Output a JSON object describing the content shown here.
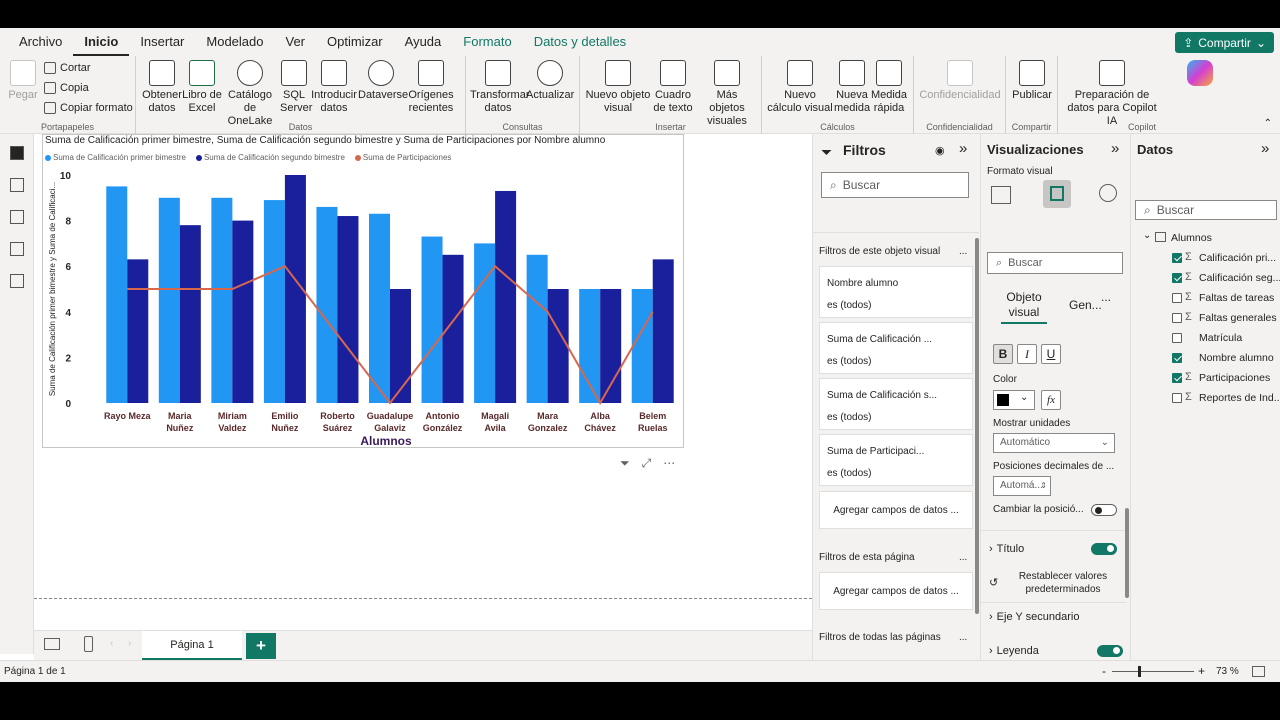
{
  "menu": {
    "items": [
      "Archivo",
      "Inicio",
      "Insertar",
      "Modelado",
      "Ver",
      "Optimizar",
      "Ayuda",
      "Formato",
      "Datos y detalles"
    ],
    "active": "Inicio",
    "share_label": "Compartir"
  },
  "ribbon": {
    "clipboard": {
      "paste": "Pegar",
      "cut": "Cortar",
      "copy": "Copia",
      "format_painter": "Copiar formato",
      "group": "Portapapeles"
    },
    "data": {
      "get_data": "Obtener datos",
      "excel": "Libro de Excel",
      "onelake": "Catálogo de OneLake",
      "sql": "SQL Server",
      "enter": "Introducir datos",
      "dataverse": "Dataverse",
      "recent": "Orígenes recientes",
      "group": "Datos"
    },
    "queries": {
      "transform": "Transformar datos",
      "refresh": "Actualizar",
      "group": "Consultas"
    },
    "insert": {
      "new_visual": "Nuevo objeto visual",
      "textbox": "Cuadro de texto",
      "more_visuals": "Más objetos visuales",
      "group": "Insertar"
    },
    "calcs": {
      "new_calc": "Nuevo cálculo visual",
      "new_measure": "Nueva medida",
      "quick_measure": "Medida rápida",
      "group": "Cálculos"
    },
    "sensitivity": {
      "label": "Confidencialidad",
      "group": "Confidencialidad"
    },
    "share": {
      "publish": "Publicar",
      "group": "Compartir"
    },
    "copilot": {
      "prepare": "Preparación de datos para Copilot IA",
      "group": "Copilot"
    }
  },
  "canvas": {
    "page_tab": "Página 1",
    "add_page": "+"
  },
  "status": {
    "page": "Página 1 de 1",
    "zoom": "73 %",
    "minus": "-",
    "plus": "+"
  },
  "chart_data": {
    "type": "bar",
    "title": "Suma de Calificación primer bimestre, Suma de Calificación segundo bimestre y Suma de Participaciones por Nombre alumno",
    "xlabel": "Alumnos",
    "ylabel": "Suma de Calificación primer bimestre y Suma de Calificaci...",
    "ylim": [
      0,
      10
    ],
    "yticks": [
      0,
      2,
      4,
      6,
      8,
      10
    ],
    "categories": [
      [
        "Rayo Meza"
      ],
      [
        "Maria",
        "Nuñez"
      ],
      [
        "Miriam",
        "Valdez"
      ],
      [
        "Emilio",
        "Nuñez"
      ],
      [
        "Roberto",
        "Suárez"
      ],
      [
        "Guadalupe",
        "Galaviz"
      ],
      [
        "Antonio",
        "González"
      ],
      [
        "Magali",
        "Avila"
      ],
      [
        "Mara",
        "Gonzalez"
      ],
      [
        "Alba",
        "Chávez"
      ],
      [
        "Belem",
        "Ruelas"
      ]
    ],
    "series": [
      {
        "name": "Suma de Calificación primer bimestre",
        "color": "#2196F3",
        "kind": "bar",
        "values": [
          9.5,
          9.0,
          9.0,
          8.9,
          8.6,
          8.3,
          7.3,
          7.0,
          6.5,
          5.0,
          5.0
        ]
      },
      {
        "name": "Suma de Calificación segundo bimestre",
        "color": "#1A1F9C",
        "kind": "bar",
        "values": [
          6.3,
          7.8,
          8.0,
          10.0,
          8.2,
          5.0,
          6.5,
          9.3,
          5.0,
          5.0,
          6.3
        ]
      },
      {
        "name": "Suma de Participaciones",
        "color": "#D9674C",
        "kind": "line",
        "values": [
          5,
          5,
          5,
          6,
          3,
          0,
          3,
          6,
          4,
          0,
          4
        ]
      }
    ],
    "legend": "top-left"
  },
  "filters": {
    "title": "Filtros",
    "search_placeholder": "Buscar",
    "this_visual": "Filtros de este objeto visual",
    "cards": [
      {
        "name": "Nombre alumno",
        "value": "es (todos)"
      },
      {
        "name": "Suma de Calificación ...",
        "value": "es (todos)"
      },
      {
        "name": "Suma de Calificación s...",
        "value": "es (todos)"
      },
      {
        "name": "Suma de Participaci...",
        "value": "es (todos)"
      }
    ],
    "add_fields": "Agregar campos de datos ...",
    "this_page": "Filtros de esta página",
    "all_pages": "Filtros de todas las páginas",
    "more": "..."
  },
  "viz": {
    "title": "Visualizaciones",
    "subtitle": "Formato visual",
    "search_placeholder": "Buscar",
    "tab_visual": "Objeto visual",
    "tab_general": "Gen...",
    "more": "...",
    "bold": "B",
    "italic": "I",
    "underline": "U",
    "color_label": "Color",
    "fx": "fx",
    "units_label": "Mostrar unidades",
    "units_value": "Automático",
    "decimals_label": "Posiciones decimales de ...",
    "decimals_value": "Automá...",
    "switch_label": "Cambiar la posició...",
    "title_section": "Título",
    "reset": "Restablecer valores predeterminados",
    "y_section": "Eje Y secundario",
    "legend_section": "Leyenda"
  },
  "datap": {
    "title": "Datos",
    "search_placeholder": "Buscar",
    "table": "Alumnos",
    "fields": [
      {
        "name": "Calificación pri...",
        "checked": true,
        "sigma": true
      },
      {
        "name": "Calificación seg...",
        "checked": true,
        "sigma": true
      },
      {
        "name": "Faltas de tareas",
        "checked": false,
        "sigma": true
      },
      {
        "name": "Faltas generales",
        "checked": false,
        "sigma": true
      },
      {
        "name": "Matrícula",
        "checked": false,
        "sigma": false
      },
      {
        "name": "Nombre alumno",
        "checked": true,
        "sigma": false
      },
      {
        "name": "Participaciones",
        "checked": true,
        "sigma": true
      },
      {
        "name": "Reportes de Ind...",
        "checked": false,
        "sigma": true
      }
    ]
  }
}
